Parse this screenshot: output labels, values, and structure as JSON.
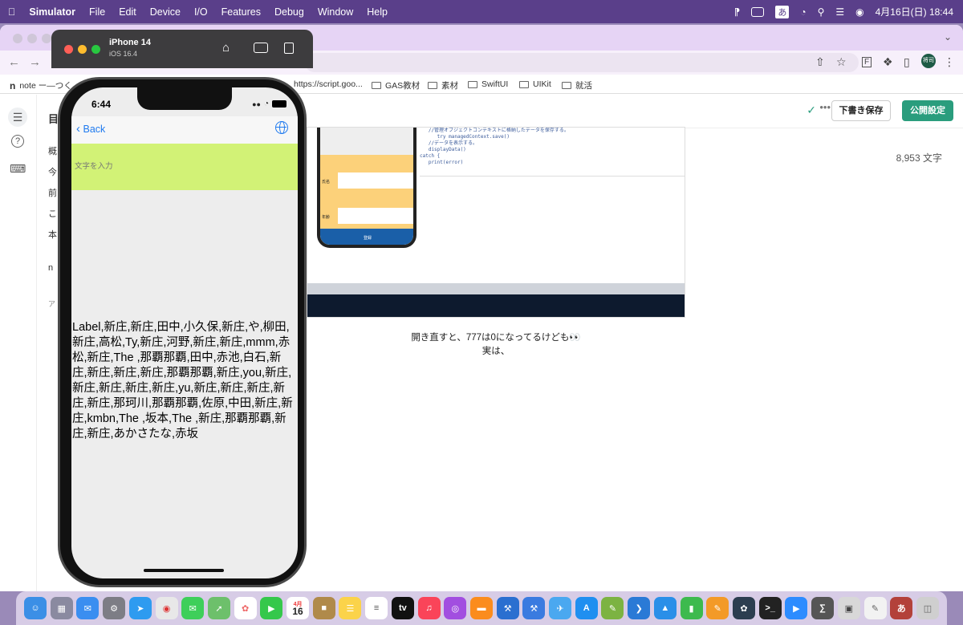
{
  "menubar": {
    "app": "Simulator",
    "items": [
      "File",
      "Edit",
      "Device",
      "I/O",
      "Features",
      "Debug",
      "Window",
      "Help"
    ],
    "ime": "あ",
    "datetime": "4月16日(日)  18:44"
  },
  "browser": {
    "bookmarks": [
      "note ー―つく",
      "https://script.goo...",
      "GAS教材",
      "素材",
      "SwiftUI",
      "UIKit",
      "就活"
    ],
    "profile_label": "将司"
  },
  "editor": {
    "draft_button": "下書き保存",
    "publish_button": "公開設定",
    "word_count": "8,953 文字",
    "left_title": "目",
    "left_fragments": [
      "概",
      "今",
      "前",
      "こ",
      "本",
      "n",
      "ア"
    ],
    "caption_line1": "開き直すと、777は0になってるけども👀",
    "caption_line2": "実は、",
    "code_lines": "   //管理オブジェクトコンテキストに格納したデータを保存する。\n      try managedContext.save()\n   //データを表示する。\n   displayData()\ncatch {\n   print(error)",
    "inner_label_name": "氏名",
    "inner_label_age": "年齢",
    "inner_button": "登録"
  },
  "simulator": {
    "device_name": "iPhone 14",
    "os_version": "iOS 16.4"
  },
  "phone": {
    "time": "6:44",
    "back_label": "Back",
    "input_placeholder": "文字を入力",
    "label_text": "Label,新庄,新庄,田中,小久保,新庄,や,柳田,新庄,高松,Ty,新庄,河野,新庄,新庄,mmm,赤松,新庄,The ,那覇那覇,田中,赤池,白石,新庄,新庄,新庄,新庄,那覇那覇,新庄,you,新庄,新庄,新庄,新庄,新庄,yu,新庄,新庄,新庄,新庄,新庄,那珂川,那覇那覇,佐原,中田,新庄,新庄,kmbn,The ,坂本,The ,新庄,那覇那覇,新庄,新庄,あかさたな,赤坂"
  },
  "dock": {
    "calendar_month": "4月",
    "calendar_day": "16",
    "apps": [
      "finder",
      "launchpad",
      "mail",
      "settings",
      "safari",
      "chrome",
      "messages",
      "maps",
      "photos",
      "facetime",
      "calendar",
      "notes-brown",
      "notes",
      "reminders",
      "appletv",
      "music",
      "podcasts",
      "books",
      "xcode",
      "simulator",
      "testflight",
      "appstore",
      "books-green",
      "vscode",
      "keynote",
      "numbers",
      "pages",
      "gpt",
      "terminal",
      "zoom",
      "calculator",
      "preview",
      "textedit",
      "dictionary",
      "trash"
    ]
  }
}
